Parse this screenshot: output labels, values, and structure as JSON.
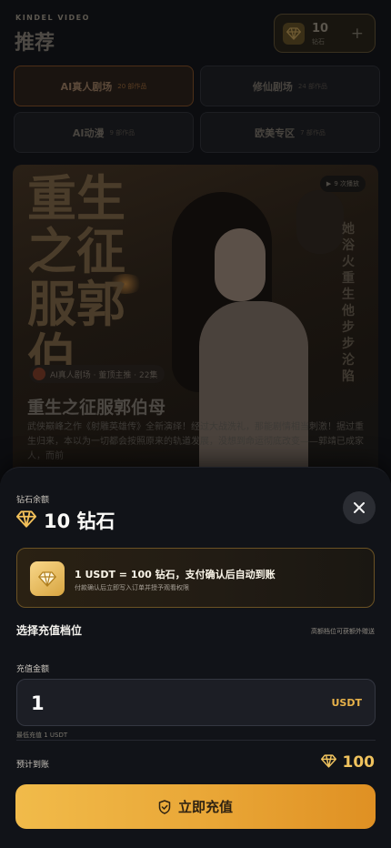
{
  "app": {
    "brand": "KINDEL VIDEO",
    "page_title": "推荐"
  },
  "balance_chip": {
    "amount": "10",
    "unit": "钻石",
    "plus": "+"
  },
  "categories": [
    {
      "name": "AI真人剧场",
      "count": "20 部作品",
      "active": true
    },
    {
      "name": "修仙剧场",
      "count": "24 部作品",
      "active": false
    },
    {
      "name": "AI动漫",
      "count": "9 部作品",
      "active": false
    },
    {
      "name": "欧美专区",
      "count": "7 部作品",
      "active": false
    }
  ],
  "featured": {
    "cover_title": "重生之征服郭伯",
    "side_text": "她浴火重生他步步沦陷",
    "plays": "9 次播放",
    "tag": "AI真人剧场 · 董顶主推 · 22集",
    "title": "重生之征服郭伯母",
    "description": "武侠巅峰之作《射雕英雄传》全新演绎！经过大战洗礼，那能剧情相当刺激！据过重生归来，本以为一切都会按照原来的轨道发展，没想到命运彻底改变——郭靖已成家人，而前"
  },
  "sheet": {
    "balance_label": "钻石余额",
    "balance_value": "10 钻石",
    "rate_main": "1 USDT = 100 钻石，支付确认后自动到账",
    "rate_sub": "付款确认后立即写入订单并授予观看权限",
    "tier_title": "选择充值档位",
    "tier_note": "高额档位可获额外赠送",
    "amount_label": "充值金额",
    "amount_value": "1",
    "amount_unit": "USDT",
    "min_note": "最低充值 1 USDT",
    "estimate_label": "预计到账",
    "estimate_value": "100",
    "cta_label": "立即充值"
  },
  "colors": {
    "accent": "#f0c35e",
    "cta_start": "#f1bb4a",
    "cta_end": "#df9023",
    "sheet_bg": "#111318"
  },
  "icons": {
    "gem": "diamond-icon",
    "close": "close-icon",
    "shield": "shield-icon",
    "play": "play-icon",
    "coin": "coin-icon"
  }
}
